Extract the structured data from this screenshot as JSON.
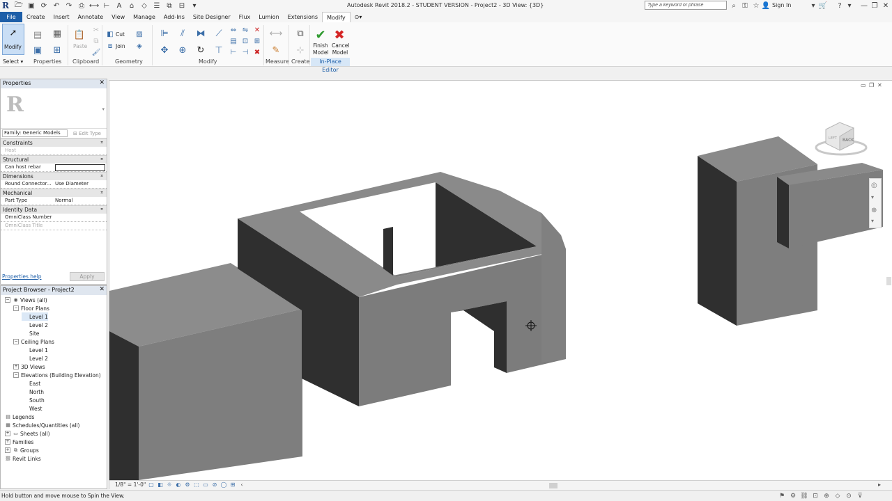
{
  "app": {
    "title": "Autodesk Revit 2018.2 - STUDENT VERSION -    Project2 - 3D View: {3D}",
    "logo_letter": "R",
    "search_placeholder": "Type a keyword or phrase",
    "sign_in": "Sign In"
  },
  "tabs": [
    "File",
    "Create",
    "Insert",
    "Annotate",
    "View",
    "Manage",
    "Add-Ins",
    "Site Designer",
    "Flux",
    "Lumion",
    "Extensions",
    "Modify",
    "⊙▾"
  ],
  "active_tab": "Modify",
  "ribbon": {
    "modify_label": "Modify",
    "paste_label": "Paste",
    "cut_label": "Cut",
    "join_label": "Join",
    "finish_model_label": "Finish Model",
    "cancel_model_label": "Cancel Model",
    "panels": {
      "select": "Select ▾",
      "properties": "Properties",
      "clipboard": "Clipboard",
      "geometry": "Geometry",
      "modify": "Modify",
      "measure": "Measure",
      "create": "Create",
      "in_place_editor": "In-Place Editor"
    }
  },
  "properties": {
    "title": "Properties",
    "family": "Family: Generic Models",
    "edit_type": "Edit Type",
    "groups": [
      {
        "name": "Constraints",
        "rows": [
          {
            "k": "Host",
            "v": "",
            "dim": true
          }
        ]
      },
      {
        "name": "Structural",
        "rows": [
          {
            "k": "Can host rebar",
            "v": "checkbox"
          }
        ]
      },
      {
        "name": "Dimensions",
        "rows": [
          {
            "k": "Round Connector...",
            "v": "Use Diameter"
          }
        ]
      },
      {
        "name": "Mechanical",
        "rows": [
          {
            "k": "Part Type",
            "v": "Normal"
          }
        ]
      },
      {
        "name": "Identity Data",
        "rows": [
          {
            "k": "OmniClass Number",
            "v": ""
          },
          {
            "k": "OmniClass Title",
            "v": "",
            "dim": true
          }
        ]
      }
    ],
    "help_link": "Properties help",
    "apply": "Apply"
  },
  "browser": {
    "title": "Project Browser - Project2",
    "items": [
      {
        "label": "Views (all)",
        "level": 0,
        "twist": "−",
        "icon": "views"
      },
      {
        "label": "Floor Plans",
        "level": 1,
        "twist": "−"
      },
      {
        "label": "Level 1",
        "level": 2,
        "selected": true
      },
      {
        "label": "Level 2",
        "level": 2
      },
      {
        "label": "Site",
        "level": 2
      },
      {
        "label": "Ceiling Plans",
        "level": 1,
        "twist": "−"
      },
      {
        "label": "Level 1",
        "level": 2
      },
      {
        "label": "Level 2",
        "level": 2
      },
      {
        "label": "3D Views",
        "level": 1,
        "twist": "+"
      },
      {
        "label": "Elevations (Building Elevation)",
        "level": 1,
        "twist": "−"
      },
      {
        "label": "East",
        "level": 2
      },
      {
        "label": "North",
        "level": 2
      },
      {
        "label": "South",
        "level": 2
      },
      {
        "label": "West",
        "level": 2
      },
      {
        "label": "Legends",
        "level": 0,
        "icon": "legend"
      },
      {
        "label": "Schedules/Quantities (all)",
        "level": 0,
        "icon": "schedule"
      },
      {
        "label": "Sheets (all)",
        "level": 0,
        "twist": "+",
        "icon": "sheet"
      },
      {
        "label": "Families",
        "level": 0,
        "twist": "+"
      },
      {
        "label": "Groups",
        "level": 0,
        "twist": "+",
        "icon": "group"
      },
      {
        "label": "Revit Links",
        "level": 0,
        "icon": "link"
      }
    ]
  },
  "viewport": {
    "scale": "1/8\" = 1'-0\"",
    "viewcube_face": "BACK",
    "viewcube_side": "LEFT"
  },
  "status": {
    "text": "Hold button and move mouse to Spin the View."
  },
  "colors": {
    "accent": "#1d5ea8",
    "model_light": "#808080",
    "model_dark": "#2f2f2f",
    "model_top": "#8c8c8c"
  }
}
